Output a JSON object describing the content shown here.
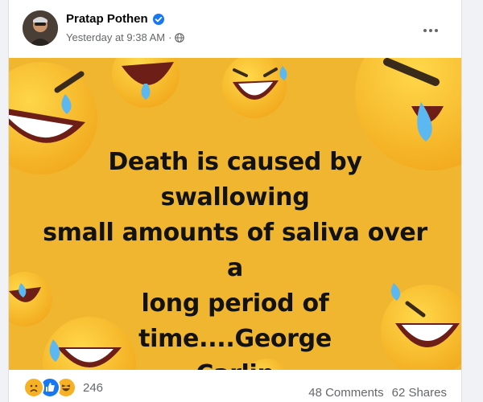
{
  "post": {
    "author_name": "Pratap Pothen",
    "timestamp": "Yesterday at 9:38 AM",
    "separator": "·",
    "privacy_icon": "globe-icon",
    "verified_icon": "verified-badge-icon",
    "more_icon": "more-options-icon"
  },
  "image": {
    "background_color": "#f0b62f",
    "quote_lines": [
      "Death is caused by swallowing",
      "small amounts of saliva over a",
      "long period of time....George",
      "Carlin"
    ],
    "decor_icon": "laughing-crying-emoji-icon"
  },
  "footer": {
    "reaction_icons": [
      "sad-reaction-icon",
      "like-reaction-icon",
      "haha-reaction-icon"
    ],
    "reaction_count": "246",
    "comments": "48 Comments",
    "shares": "62 Shares"
  },
  "colors": {
    "accent": "#1877f2",
    "text_primary": "#050505",
    "text_secondary": "#65676b"
  }
}
